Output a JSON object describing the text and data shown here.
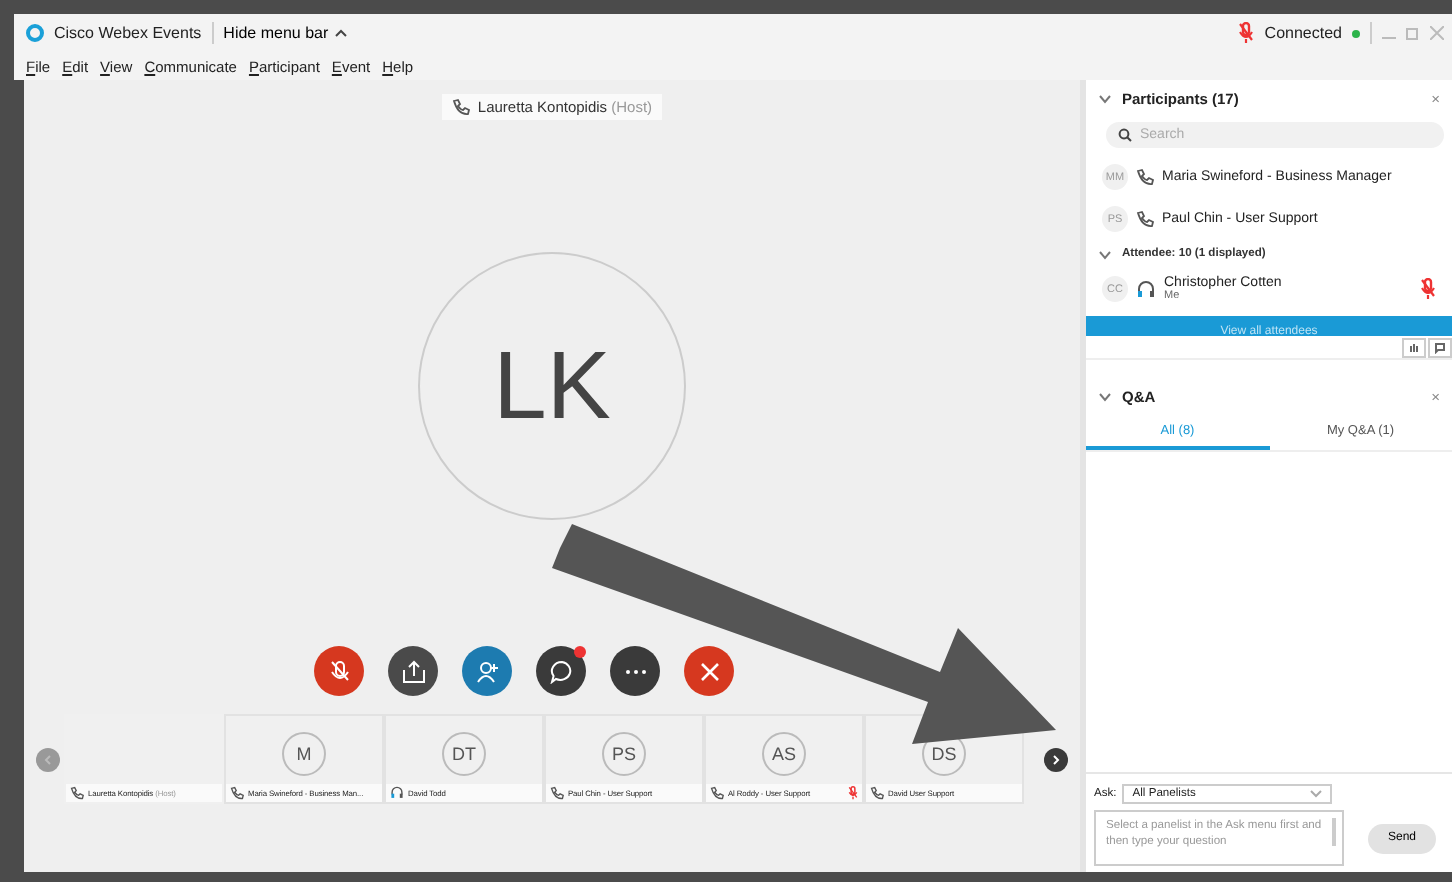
{
  "window": {
    "title": "Cisco Webex Events",
    "menu_toggle": "Hide menu bar",
    "status": "Connected",
    "connected": true,
    "muted": true
  },
  "menu": [
    "File",
    "Edit",
    "View",
    "Communicate",
    "Participant",
    "Event",
    "Help"
  ],
  "stage": {
    "speaker": "Lauretta Kontopidis",
    "speaker_role": "(Host)",
    "initials": "LK"
  },
  "controls": [
    {
      "kind": "mute"
    },
    {
      "kind": "share"
    },
    {
      "kind": "participants"
    },
    {
      "kind": "chat",
      "badge": true
    },
    {
      "kind": "more"
    },
    {
      "kind": "leave"
    }
  ],
  "thumbnails": [
    {
      "name": "Lauretta Kontopidis",
      "role": "(Host)",
      "kind": "phone",
      "muted": false
    },
    {
      "initials": "M",
      "name": "Maria Swineford - Business Man...",
      "kind": "phone",
      "muted": false
    },
    {
      "initials": "DT",
      "name": "David Todd",
      "kind": "computer",
      "muted": false
    },
    {
      "initials": "PS",
      "name": "Paul Chin - User Support",
      "kind": "phone",
      "muted": false
    },
    {
      "initials": "AS",
      "name": "Al Roddy - User Support",
      "kind": "phone",
      "muted": true
    },
    {
      "initials": "DS",
      "name": "David User Support",
      "kind": "phone",
      "muted": false
    }
  ],
  "participants": {
    "title": "Participants (17)",
    "search_placeholder": "Search",
    "panelists": [
      {
        "initials": "MM",
        "name": "Maria Swineford - Business Manager",
        "kind": "phone",
        "muted": false
      },
      {
        "initials": "PS",
        "name": "Paul Chin - User Support",
        "kind": "phone",
        "muted": false
      }
    ],
    "attendee_group": {
      "label": "Attendee: 10 (1 displayed)",
      "expanded": true,
      "members": [
        {
          "initials": "CC",
          "name": "Christopher Cotten",
          "note": "Me",
          "kind": "computer",
          "muted": true
        }
      ]
    },
    "view_all": "View all attendees",
    "close": "×"
  },
  "qa": {
    "title": "Q&A",
    "tabs": [
      {
        "label": "All (8)",
        "selected": true
      },
      {
        "label": "My Q&A (1)",
        "selected": false
      }
    ],
    "close": "×",
    "ask_label": "Ask:",
    "ask_value": "All Panelists",
    "placeholder": "Select a panelist in the Ask menu first and then type your question",
    "send": "Send"
  }
}
